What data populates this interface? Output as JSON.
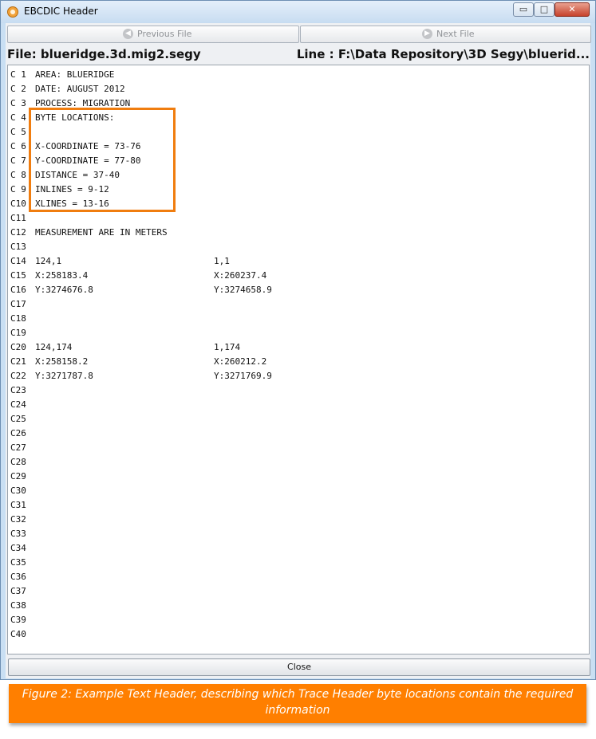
{
  "window": {
    "title": "EBCDIC Header",
    "minimize": "▭",
    "maximize": "□",
    "close": "✕"
  },
  "nav": {
    "previous_label": "Previous File",
    "next_label": "Next File",
    "previous_icon": "arrow-left-icon",
    "next_icon": "arrow-right-icon"
  },
  "file": {
    "name": "File: blueridge.3d.mig2.segy",
    "line": "Line : F:\\Data Repository\\3D Segy\\bluerid..."
  },
  "header_lines": [
    {
      "label": "C 1",
      "text": "AREA: BLUERIDGE",
      "text2": ""
    },
    {
      "label": "C 2",
      "text": "DATE: AUGUST 2012",
      "text2": ""
    },
    {
      "label": "C 3",
      "text": "PROCESS: MIGRATION",
      "text2": ""
    },
    {
      "label": "C 4",
      "text": "BYTE LOCATIONS:",
      "text2": ""
    },
    {
      "label": "C 5",
      "text": "",
      "text2": ""
    },
    {
      "label": "C 6",
      "text": "X-COORDINATE = 73-76",
      "text2": ""
    },
    {
      "label": "C 7",
      "text": "Y-COORDINATE = 77-80",
      "text2": ""
    },
    {
      "label": "C 8",
      "text": "DISTANCE = 37-40",
      "text2": ""
    },
    {
      "label": "C 9",
      "text": "INLINES = 9-12",
      "text2": ""
    },
    {
      "label": "C10",
      "text": "XLINES = 13-16",
      "text2": ""
    },
    {
      "label": "C11",
      "text": "",
      "text2": ""
    },
    {
      "label": "C12",
      "text": "MEASUREMENT ARE IN METERS",
      "text2": ""
    },
    {
      "label": "C13",
      "text": "",
      "text2": ""
    },
    {
      "label": "C14",
      "text": "124,1",
      "text2": "1,1"
    },
    {
      "label": "C15",
      "text": "X:258183.4",
      "text2": "X:260237.4"
    },
    {
      "label": "C16",
      "text": "Y:3274676.8",
      "text2": "Y:3274658.9"
    },
    {
      "label": "C17",
      "text": "",
      "text2": ""
    },
    {
      "label": "C18",
      "text": "",
      "text2": ""
    },
    {
      "label": "C19",
      "text": "",
      "text2": ""
    },
    {
      "label": "C20",
      "text": "124,174",
      "text2": "1,174"
    },
    {
      "label": "C21",
      "text": "X:258158.2",
      "text2": "X:260212.2"
    },
    {
      "label": "C22",
      "text": "Y:3271787.8",
      "text2": "Y:3271769.9"
    },
    {
      "label": "C23",
      "text": "",
      "text2": ""
    },
    {
      "label": "C24",
      "text": "",
      "text2": ""
    },
    {
      "label": "C25",
      "text": "",
      "text2": ""
    },
    {
      "label": "C26",
      "text": "",
      "text2": ""
    },
    {
      "label": "C27",
      "text": "",
      "text2": ""
    },
    {
      "label": "C28",
      "text": "",
      "text2": ""
    },
    {
      "label": "C29",
      "text": "",
      "text2": ""
    },
    {
      "label": "C30",
      "text": "",
      "text2": ""
    },
    {
      "label": "C31",
      "text": "",
      "text2": ""
    },
    {
      "label": "C32",
      "text": "",
      "text2": ""
    },
    {
      "label": "C33",
      "text": "",
      "text2": ""
    },
    {
      "label": "C34",
      "text": "",
      "text2": ""
    },
    {
      "label": "C35",
      "text": "",
      "text2": ""
    },
    {
      "label": "C36",
      "text": "",
      "text2": ""
    },
    {
      "label": "C37",
      "text": "",
      "text2": ""
    },
    {
      "label": "C38",
      "text": "",
      "text2": ""
    },
    {
      "label": "C39",
      "text": "",
      "text2": ""
    },
    {
      "label": "C40",
      "text": "",
      "text2": ""
    }
  ],
  "footer": {
    "close_label": "Close"
  },
  "caption": "Figure 2: Example Text Header, describing which Trace Header byte locations contain the required information",
  "colors": {
    "highlight": "#f07d0f",
    "caption_bg": "#ff7f00",
    "caption_text": "#ffffff"
  }
}
